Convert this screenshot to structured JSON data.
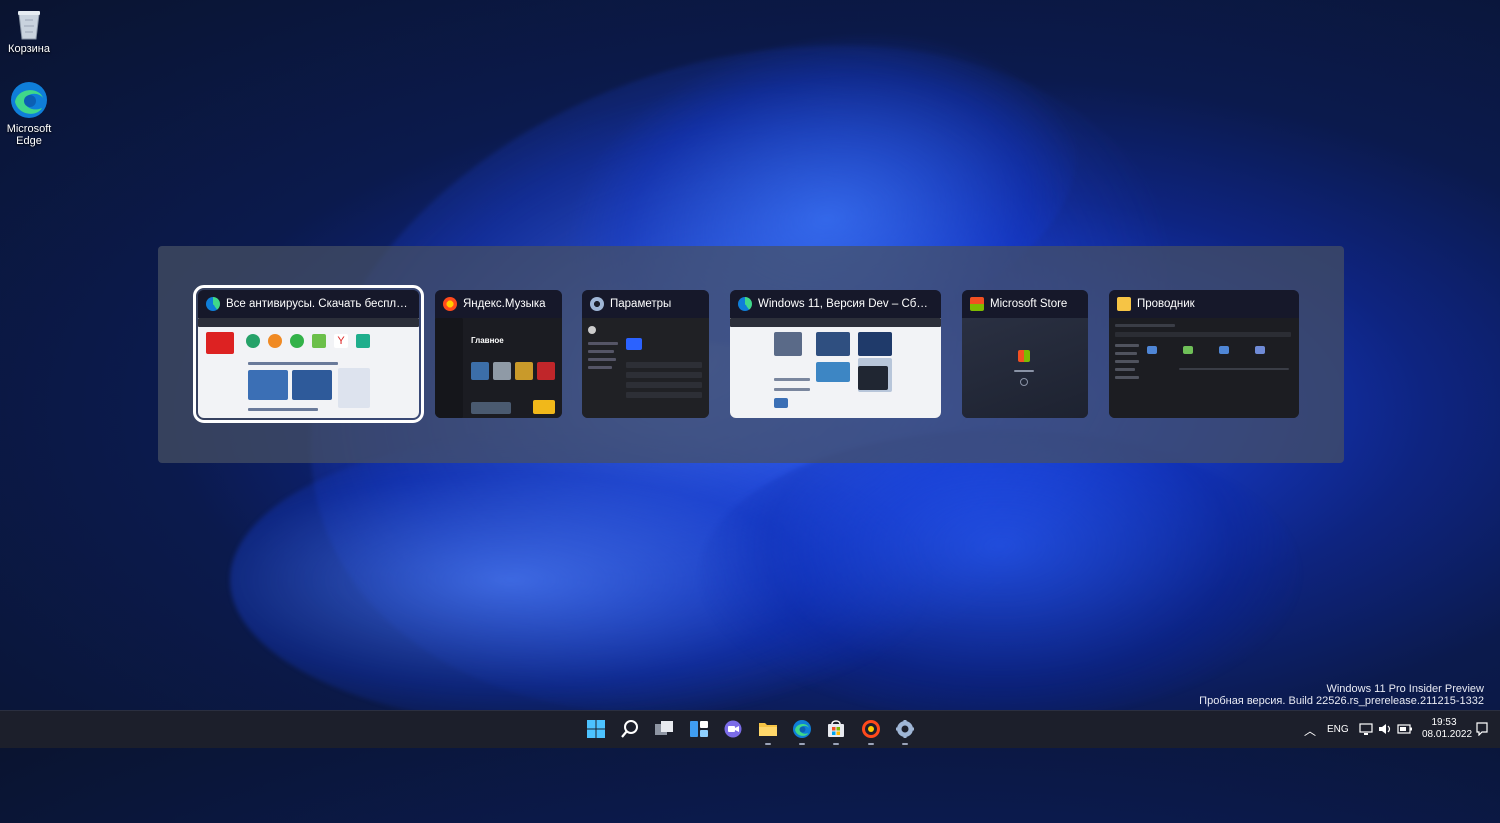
{
  "desktop": {
    "icons": [
      {
        "label": "Корзина"
      },
      {
        "label": "Microsoft Edge"
      }
    ]
  },
  "switcher": {
    "windows": [
      {
        "title": "Все антивирусы. Скачать бесплат...",
        "icon": "edge-icon",
        "selected": true
      },
      {
        "title": "Яндекс.Музыка",
        "icon": "yandex-music-icon",
        "selected": false
      },
      {
        "title": "Параметры",
        "icon": "gear-icon",
        "selected": false
      },
      {
        "title": "Windows 11, Версия Dev – Сборки...",
        "icon": "edge-icon",
        "selected": false
      },
      {
        "title": "Microsoft Store",
        "icon": "store-icon",
        "selected": false
      },
      {
        "title": "Проводник",
        "icon": "folder-icon",
        "selected": false
      }
    ],
    "thumb_texts": {
      "music_heading": "Главное"
    }
  },
  "watermark": {
    "line1": "Windows 11 Pro Insider Preview",
    "line2": "Пробная версия. Build 22526.rs_prerelease.211215-1332"
  },
  "taskbar": {
    "apps": [
      "start-icon",
      "search-icon",
      "task-view-icon",
      "widgets-icon",
      "chat-icon",
      "explorer-icon",
      "edge-icon",
      "store-icon",
      "yandex-music-icon",
      "settings-icon"
    ],
    "tray": {
      "language": "ENG",
      "time": "19:53",
      "date": "08.01.2022"
    }
  },
  "colors": {
    "accent": "#2b62ff",
    "taskbar": "#1c1f2b"
  }
}
